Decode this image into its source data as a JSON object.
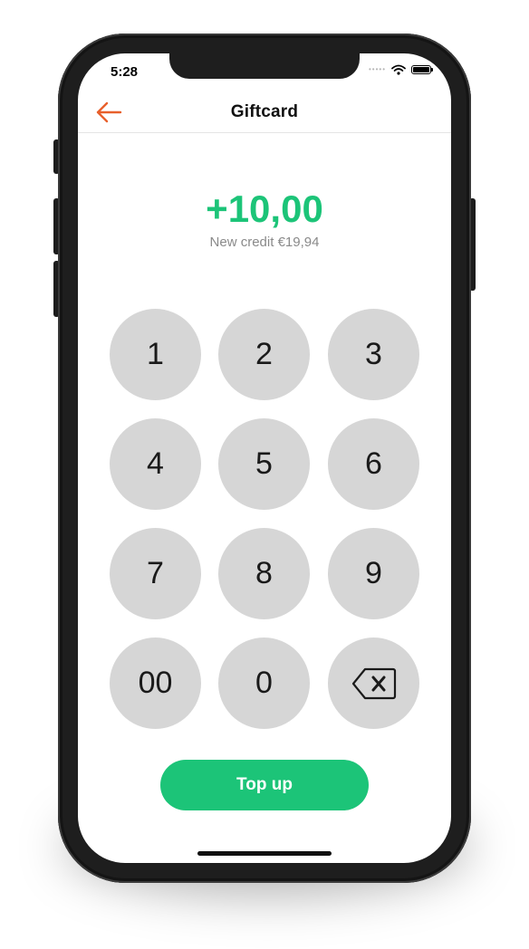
{
  "status_bar": {
    "time": "5:28",
    "signal_icon": "signal-dots-icon",
    "wifi_icon": "wifi-icon",
    "battery_icon": "battery-icon",
    "battery_level": 1.0
  },
  "header": {
    "title": "Giftcard",
    "back_icon": "arrow-left-icon"
  },
  "amount": {
    "value": "+10,00",
    "subtext": "New credit €19,94"
  },
  "keypad": {
    "keys": [
      "1",
      "2",
      "3",
      "4",
      "5",
      "6",
      "7",
      "8",
      "9",
      "00",
      "0"
    ],
    "backspace_icon": "backspace-icon"
  },
  "actions": {
    "top_up_label": "Top up"
  },
  "colors": {
    "accent": "#1cc478",
    "back_arrow": "#e8602c",
    "key_background": "#d6d6d6",
    "device_frame": "#1e1e1e"
  }
}
